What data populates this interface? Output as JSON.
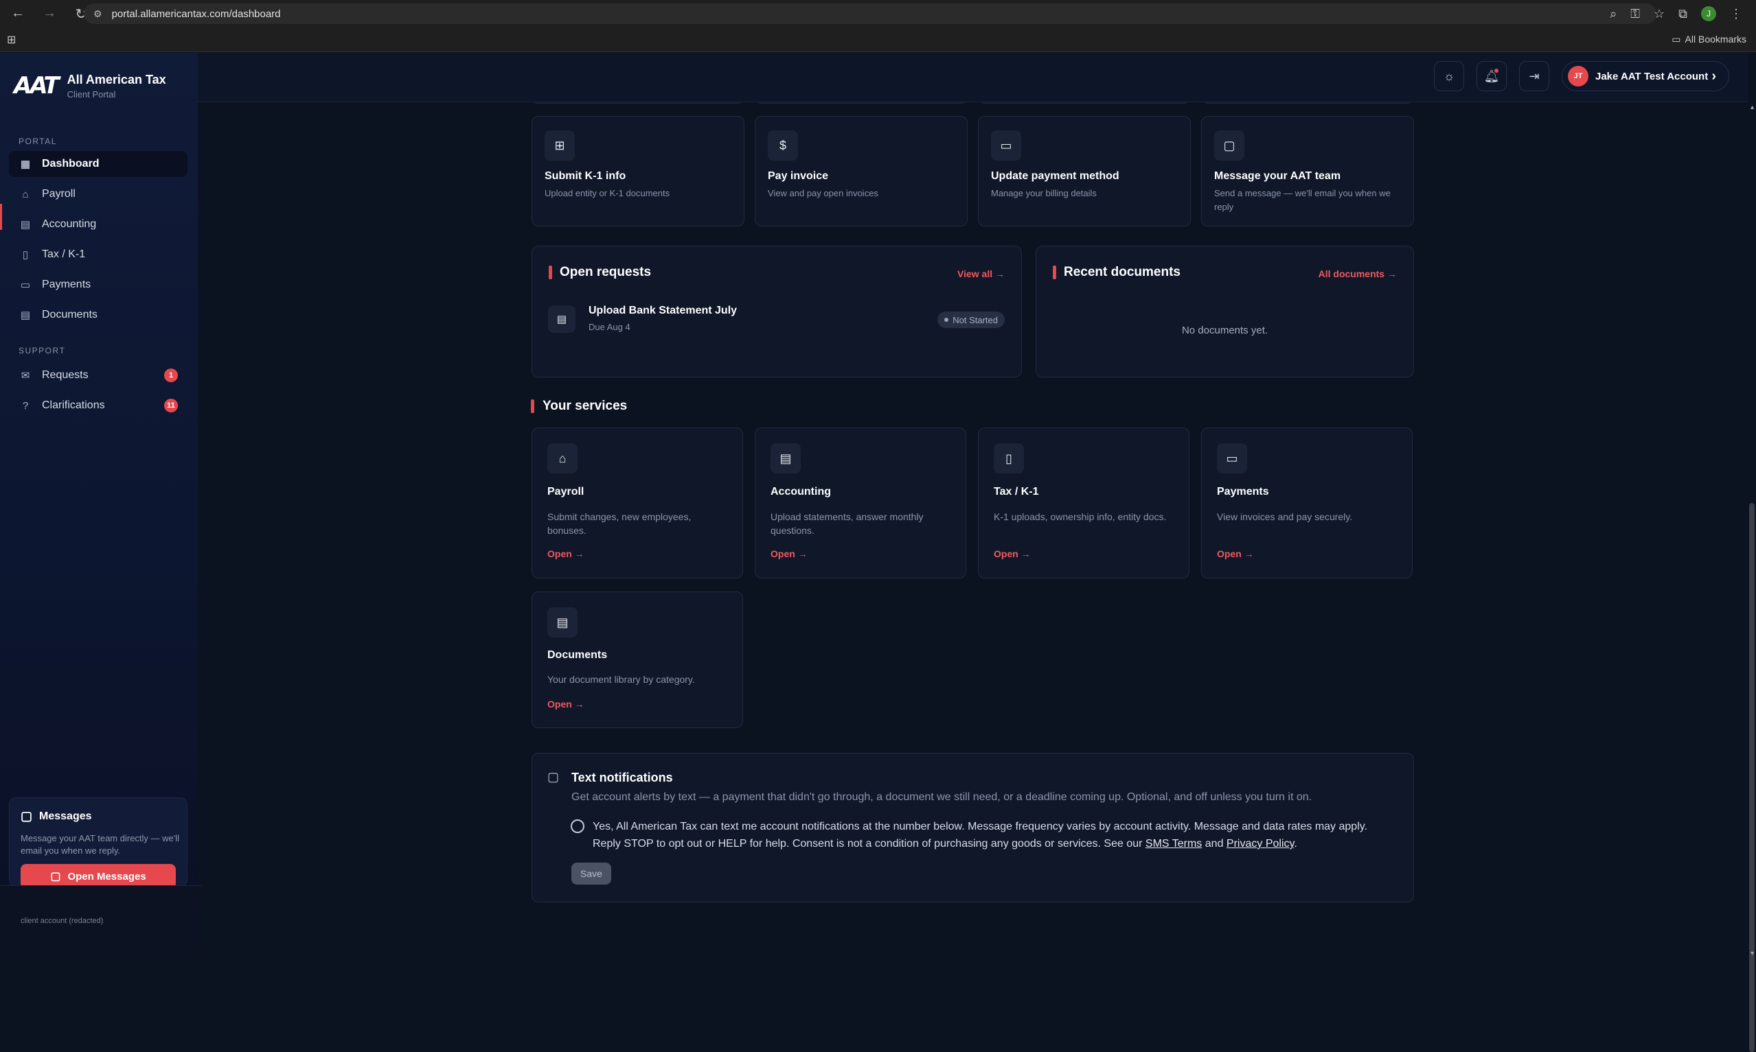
{
  "browser": {
    "url": "portal.allamericantax.com/dashboard",
    "bookmarks_label": "All Bookmarks",
    "profile_initial": "J"
  },
  "brand": {
    "logo_text": "AAT",
    "name": "All American Tax",
    "subtitle": "Client Portal"
  },
  "sidebar": {
    "portal_label": "PORTAL",
    "support_label": "SUPPORT",
    "items": [
      {
        "label": "Dashboard",
        "icon": "grid-icon"
      },
      {
        "label": "Payroll",
        "icon": "briefcase-icon"
      },
      {
        "label": "Accounting",
        "icon": "calculator-icon"
      },
      {
        "label": "Tax / K-1",
        "icon": "file-icon"
      },
      {
        "label": "Payments",
        "icon": "credit-card-icon"
      },
      {
        "label": "Documents",
        "icon": "clipboard-icon"
      }
    ],
    "support_items": [
      {
        "label": "Requests",
        "badge": "1",
        "icon": "inbox-icon"
      },
      {
        "label": "Clarifications",
        "badge": "11",
        "icon": "help-circle-icon"
      }
    ],
    "messages": {
      "title": "Messages",
      "description": "Message your AAT team directly — we'll email you when we reply.",
      "button": "Open Messages"
    },
    "footer": "client account (redacted)"
  },
  "header": {
    "account_initials": "JT",
    "account_name": "Jake AAT Test Account"
  },
  "quick_actions": [
    {
      "title": "Submit K-1 info",
      "desc": "Upload entity or K-1 documents",
      "icon": "file-plus-icon"
    },
    {
      "title": "Pay invoice",
      "desc": "View and pay open invoices",
      "icon": "dollar-icon"
    },
    {
      "title": "Update payment method",
      "desc": "Manage your billing details",
      "icon": "credit-card-icon"
    },
    {
      "title": "Message your AAT team",
      "desc": "Send a message — we'll email you when we reply",
      "icon": "message-icon"
    }
  ],
  "open_requests": {
    "title": "Open requests",
    "link": "View all →",
    "items": [
      {
        "title": "Upload Bank Statement July",
        "due": "Due Aug 4",
        "status": "Not Started"
      }
    ]
  },
  "recent_documents": {
    "title": "Recent documents",
    "link": "All documents →",
    "empty": "No documents yet."
  },
  "services": {
    "title": "Your services",
    "open_label": "Open →",
    "items": [
      {
        "title": "Payroll",
        "desc": "Submit changes, new employees, bonuses.",
        "icon": "briefcase-icon"
      },
      {
        "title": "Accounting",
        "desc": "Upload statements, answer monthly questions.",
        "icon": "calculator-icon"
      },
      {
        "title": "Tax / K-1",
        "desc": "K-1 uploads, ownership info, entity docs.",
        "icon": "file-icon"
      },
      {
        "title": "Payments",
        "desc": "View invoices and pay securely.",
        "icon": "credit-card-icon"
      },
      {
        "title": "Documents",
        "desc": "Your document library by category.",
        "icon": "clipboard-icon"
      }
    ]
  },
  "text_notifications": {
    "title": "Text notifications",
    "description": "Get account alerts by text — a payment that didn't go through, a document we still need, or a deadline coming up. Optional, and off unless you turn it on.",
    "consent_line1": "Yes, All American Tax can text me account notifications at the number below. Message frequency varies by account activity. Message and data rates may apply.",
    "consent_line2": "Reply STOP to opt out or HELP for help. Consent is not a condition of purchasing any goods or services. See our",
    "sms_terms": "SMS Terms",
    "and": "and",
    "privacy": "Privacy Policy",
    "save": "Save"
  }
}
